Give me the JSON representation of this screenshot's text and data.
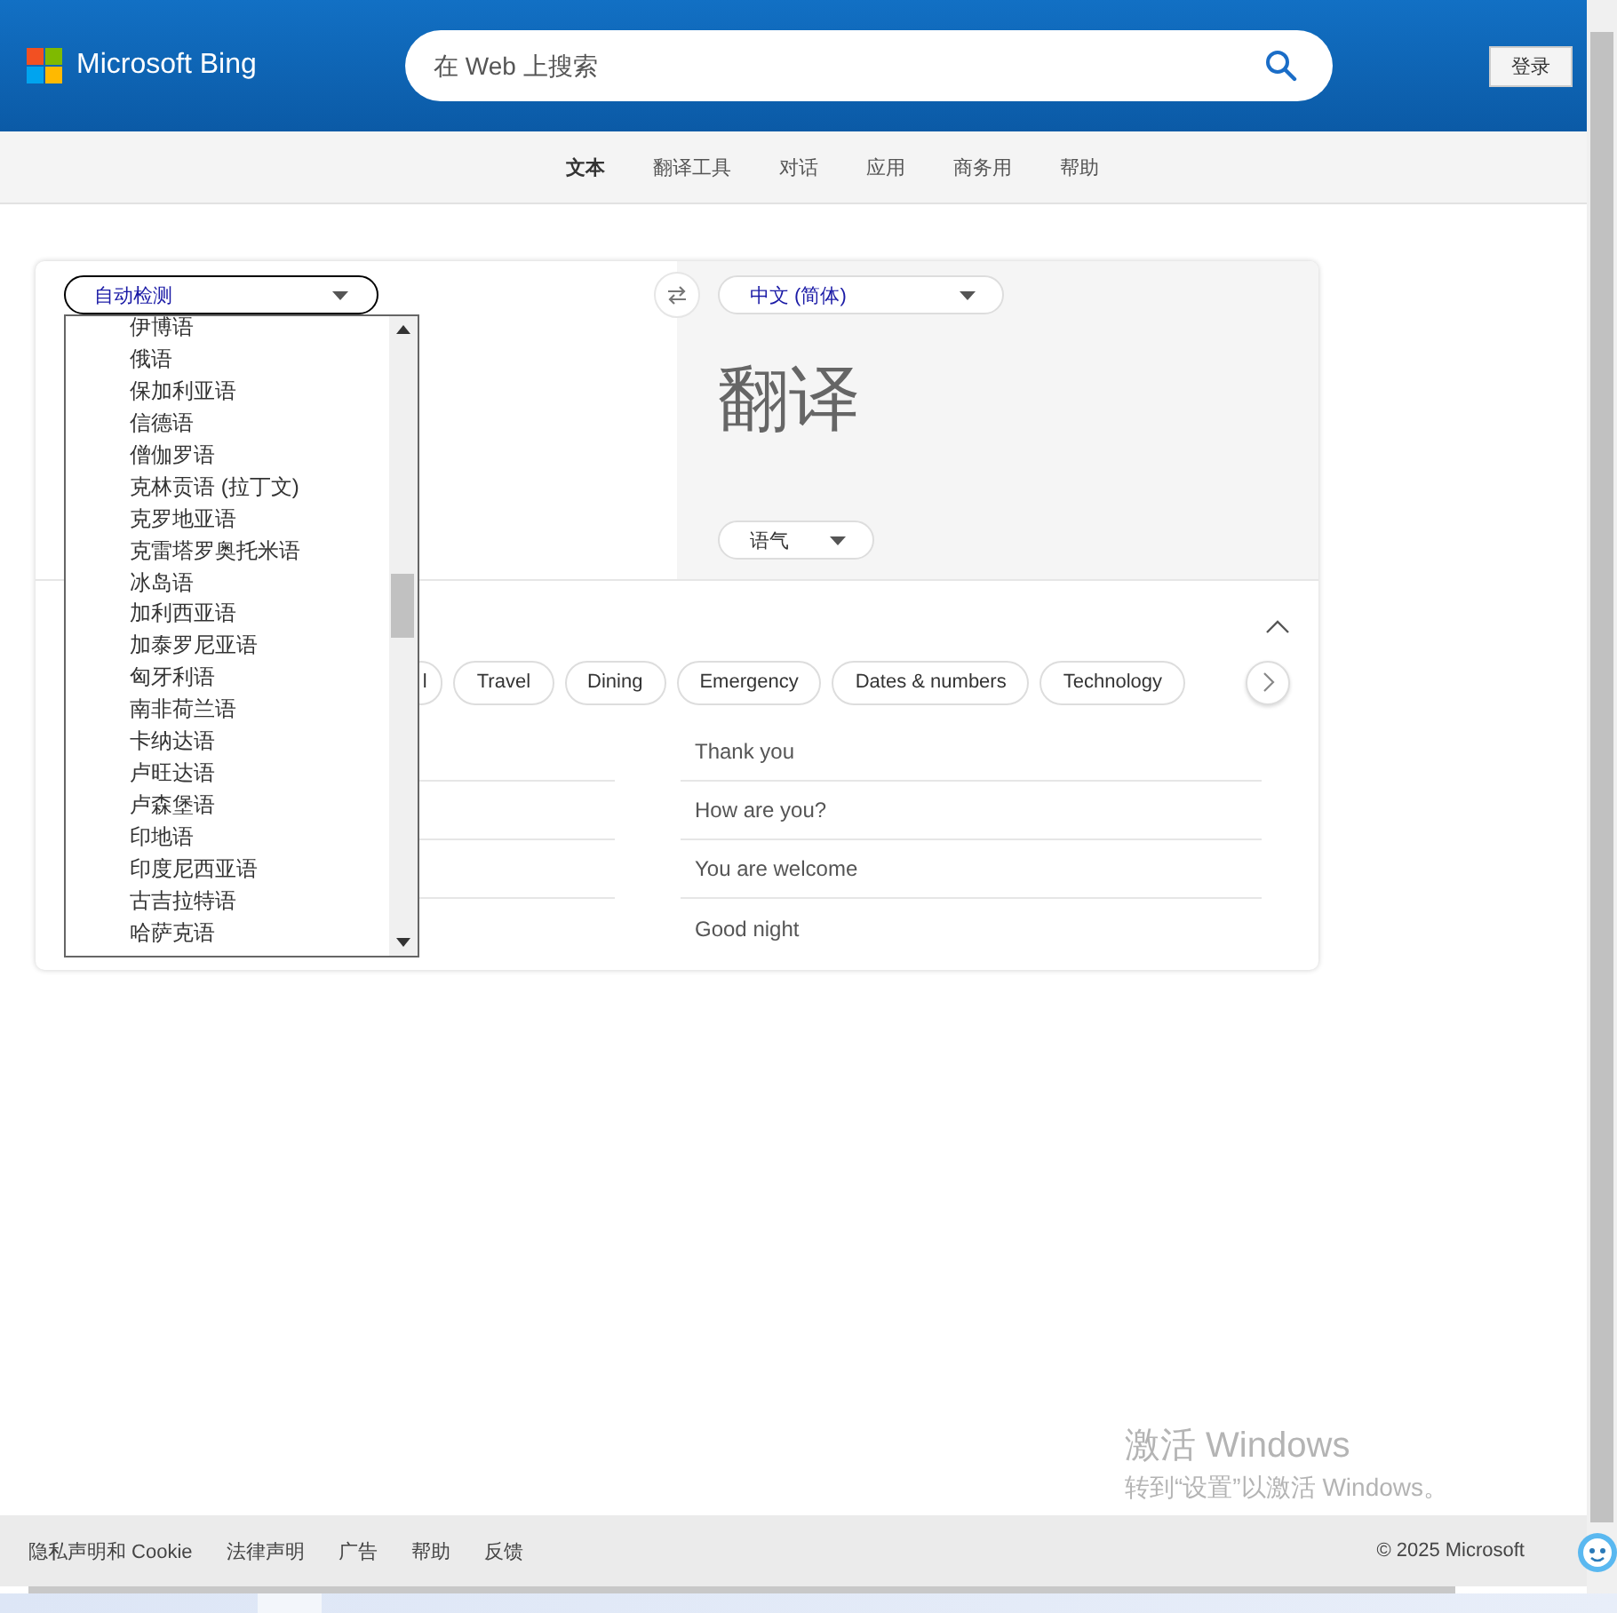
{
  "header": {
    "brand": "Microsoft Bing",
    "search": {
      "placeholder": "在 Web 上搜索"
    },
    "sign_in": "登录"
  },
  "nav": [
    {
      "label": "文本",
      "selected": true
    },
    {
      "label": "翻译工具",
      "selected": false
    },
    {
      "label": "对话",
      "selected": false
    },
    {
      "label": "应用",
      "selected": false
    },
    {
      "label": "商务用",
      "selected": false
    },
    {
      "label": "帮助",
      "selected": false
    }
  ],
  "translator": {
    "source": {
      "value": "自动检测",
      "expanded": true,
      "options": [
        "伊博语",
        "俄语",
        "保加利亚语",
        "信德语",
        "僧伽罗语",
        "克林贡语 (拉丁文)",
        "克罗地亚语",
        "克雷塔罗奥托米语",
        "冰岛语",
        "加利西亚语",
        "加泰罗尼亚语",
        "匈牙利语",
        "南非荷兰语",
        "卡纳达语",
        "卢旺达语",
        "卢森堡语",
        "印地语",
        "印度尼西亚语",
        "古吉拉特语",
        "哈萨克语"
      ]
    },
    "target": {
      "value": "中文 (简体)"
    },
    "output": "翻译",
    "tone": "语气",
    "phrases": {
      "expanded": true,
      "categories": [
        "l",
        "Travel",
        "Dining",
        "Emergency",
        "Dates & numbers",
        "Technology"
      ],
      "items": [
        "Thank you",
        "How are you?",
        "You are welcome",
        "Good night"
      ]
    }
  },
  "footer": {
    "links": [
      "隐私声明和 Cookie",
      "法律声明",
      "广告",
      "帮助",
      "反馈"
    ],
    "copyright": "© 2025 Microsoft"
  },
  "os_notice": {
    "title": "激活 Windows",
    "text": "转到“设置”以激活 Windows。"
  }
}
